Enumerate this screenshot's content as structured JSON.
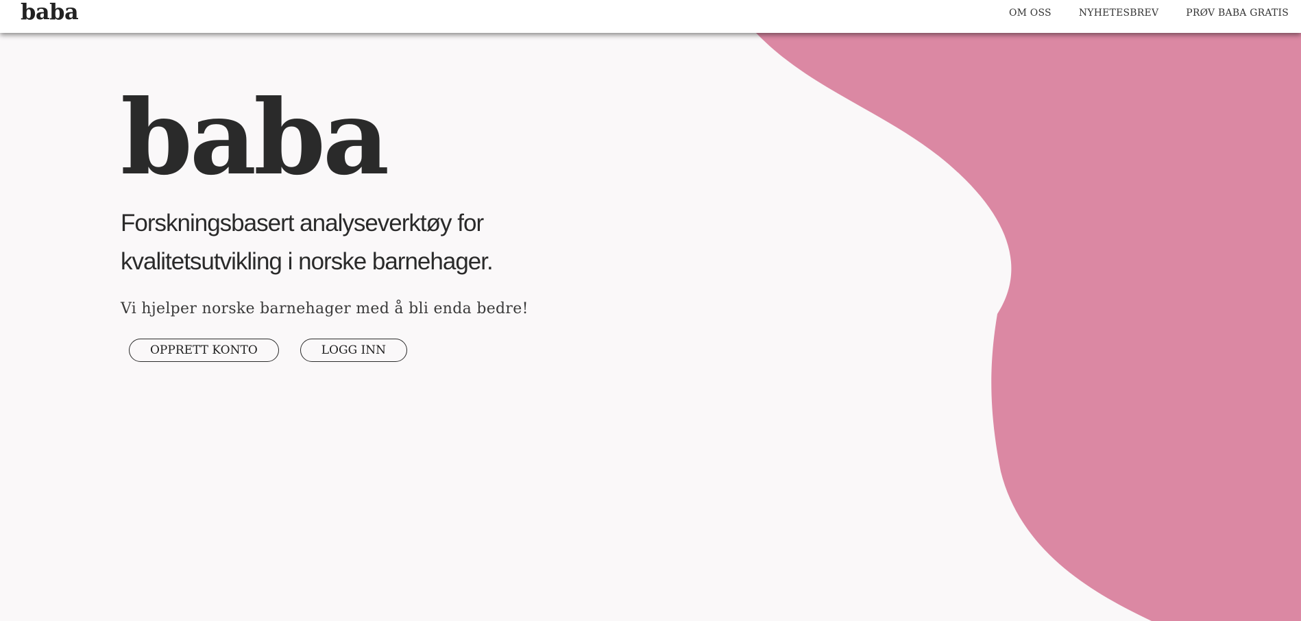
{
  "header": {
    "brand": "baba",
    "nav": [
      {
        "label": "OM OSS"
      },
      {
        "label": "NYHETESBREV"
      },
      {
        "label": "PRØV BABA GRATIS"
      }
    ]
  },
  "hero": {
    "logo": "baba",
    "tagline": "Forskningsbasert analyseverktøy for kvalitetsutvikling i norske barnehager.",
    "subtitle": "Vi hjelper norske barnehager med å bli enda bedre!",
    "buttons": {
      "create_account": "OPPRETT KONTO",
      "login": "LOGG INN"
    }
  },
  "colors": {
    "background": "#faf8f9",
    "accent_blob": "#db88a3",
    "text": "#2a2a2a"
  }
}
